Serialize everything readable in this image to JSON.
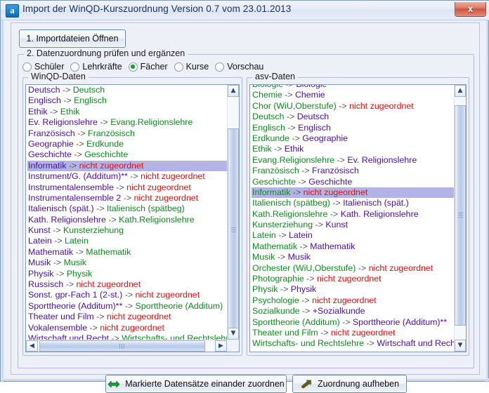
{
  "window": {
    "title": "Import der WinQD-Kurszuordnung Version 0.7 vom 23.01.2013",
    "app_icon": "a",
    "close_label": "x",
    "accent_selection": "#b3b3e8",
    "color_source_left": "#4b0fa0",
    "color_source_right": "#0e8a1e",
    "color_unmapped": "#d81111",
    "color_radio_dot": "#13a438"
  },
  "toolbar": {
    "import_label": "1. Importdateien Öffnen"
  },
  "group": {
    "legend": "2. Datenzuordnung prüfen und ergänzen",
    "radios": [
      {
        "label": "Schüler",
        "checked": false
      },
      {
        "label": "Lehrkräfte",
        "checked": false
      },
      {
        "label": "Fächer",
        "checked": true
      },
      {
        "label": "Kurse",
        "checked": false
      },
      {
        "label": "Vorschau",
        "checked": false
      }
    ]
  },
  "left_panel": {
    "legend": "WinQD-Daten",
    "arrow": "->",
    "items": [
      {
        "source": "Deutsch",
        "target": "Deutsch",
        "mapped": true,
        "selected": false
      },
      {
        "source": "Englisch",
        "target": "Englisch",
        "mapped": true,
        "selected": false
      },
      {
        "source": "Ethik",
        "target": "Ethik",
        "mapped": true,
        "selected": false
      },
      {
        "source": "Ev. Religionslehre",
        "target": "Evang.Religionslehre",
        "mapped": true,
        "selected": false
      },
      {
        "source": "Französisch",
        "target": "Französisch",
        "mapped": true,
        "selected": false
      },
      {
        "source": "Geographie",
        "target": "Erdkunde",
        "mapped": true,
        "selected": false
      },
      {
        "source": "Geschichte",
        "target": "Geschichte",
        "mapped": true,
        "selected": false
      },
      {
        "source": "Informatik",
        "target": "nicht zugeordnet",
        "mapped": false,
        "selected": true
      },
      {
        "source": "Instrument/G. (Additum)**",
        "target": "nicht zugeordnet",
        "mapped": false,
        "selected": false
      },
      {
        "source": "Instrumentalensemble",
        "target": "nicht zugeordnet",
        "mapped": false,
        "selected": false
      },
      {
        "source": "Instrumentalensemble 2",
        "target": "nicht zugeordnet",
        "mapped": false,
        "selected": false
      },
      {
        "source": "Italienisch (spät.)",
        "target": "Italienisch (spätbeg)",
        "mapped": true,
        "selected": false
      },
      {
        "source": "Kath. Religionslehre",
        "target": "Kath.Religionslehre",
        "mapped": true,
        "selected": false
      },
      {
        "source": "Kunst",
        "target": "Kunsterziehung",
        "mapped": true,
        "selected": false
      },
      {
        "source": "Latein",
        "target": "Latein",
        "mapped": true,
        "selected": false
      },
      {
        "source": "Mathematik",
        "target": "Mathematik",
        "mapped": true,
        "selected": false
      },
      {
        "source": "Musik",
        "target": "Musik",
        "mapped": true,
        "selected": false
      },
      {
        "source": "Physik",
        "target": "Physik",
        "mapped": true,
        "selected": false
      },
      {
        "source": "Russisch",
        "target": "nicht zugeordnet",
        "mapped": false,
        "selected": false
      },
      {
        "source": "Sonst. gpr-Fach 1 (2-st.)",
        "target": "nicht zugeordnet",
        "mapped": false,
        "selected": false
      },
      {
        "source": "Sporttheorie (Additum)**",
        "target": "Sporttheorie (Additum)",
        "mapped": true,
        "selected": false
      },
      {
        "source": "Theater und Film",
        "target": "nicht zugeordnet",
        "mapped": false,
        "selected": false
      },
      {
        "source": "Vokalensemble",
        "target": "nicht zugeordnet",
        "mapped": false,
        "selected": false
      },
      {
        "source": "Wirtschaft und Recht",
        "target": "Wirtschafts- und Rechtslehre",
        "mapped": true,
        "selected": false
      }
    ]
  },
  "right_panel": {
    "legend": "asv-Daten",
    "arrow": "->",
    "items": [
      {
        "source": "Biologie",
        "target": "Biologie",
        "mapped": true,
        "selected": false
      },
      {
        "source": "Chemie",
        "target": "Chemie",
        "mapped": true,
        "selected": false
      },
      {
        "source": "Chor (WiU,Oberstufe)",
        "target": "nicht zugeordnet",
        "mapped": false,
        "selected": false
      },
      {
        "source": "Deutsch",
        "target": "Deutsch",
        "mapped": true,
        "selected": false
      },
      {
        "source": "Englisch",
        "target": "Englisch",
        "mapped": true,
        "selected": false
      },
      {
        "source": "Erdkunde",
        "target": "Geographie",
        "mapped": true,
        "selected": false
      },
      {
        "source": "Ethik",
        "target": "Ethik",
        "mapped": true,
        "selected": false
      },
      {
        "source": "Evang.Religionslehre",
        "target": "Ev. Religionslehre",
        "mapped": true,
        "selected": false
      },
      {
        "source": "Französisch",
        "target": "Französisch",
        "mapped": true,
        "selected": false
      },
      {
        "source": "Geschichte",
        "target": "Geschichte",
        "mapped": true,
        "selected": false
      },
      {
        "source": "Informatik",
        "target": "nicht zugeordnet",
        "mapped": false,
        "selected": true
      },
      {
        "source": "Italienisch (spätbeg)",
        "target": "Italienisch (spät.)",
        "mapped": true,
        "selected": false
      },
      {
        "source": "Kath.Religionslehre",
        "target": "Kath. Religionslehre",
        "mapped": true,
        "selected": false
      },
      {
        "source": "Kunsterziehung",
        "target": "Kunst",
        "mapped": true,
        "selected": false
      },
      {
        "source": "Latein",
        "target": "Latein",
        "mapped": true,
        "selected": false
      },
      {
        "source": "Mathematik",
        "target": "Mathematik",
        "mapped": true,
        "selected": false
      },
      {
        "source": "Musik",
        "target": "Musik",
        "mapped": true,
        "selected": false
      },
      {
        "source": "Orchester (WiU,Oberstufe)",
        "target": "nicht zugeordnet",
        "mapped": false,
        "selected": false
      },
      {
        "source": "Photographie",
        "target": "nicht zugeordnet",
        "mapped": false,
        "selected": false
      },
      {
        "source": "Physik",
        "target": "Physik",
        "mapped": true,
        "selected": false
      },
      {
        "source": "Psychologie",
        "target": "nicht zugeordnet",
        "mapped": false,
        "selected": false
      },
      {
        "source": "Sozialkunde",
        "target": "+Sozialkunde",
        "mapped": true,
        "selected": false
      },
      {
        "source": "Sporttheorie (Additum)",
        "target": "Sporttheorie (Additum)**",
        "mapped": true,
        "selected": false
      },
      {
        "source": "Theater und Film",
        "target": "nicht zugeordnet",
        "mapped": false,
        "selected": false
      },
      {
        "source": "Wirtschafts- und Rechtslehre",
        "target": "Wirtschaft und Recht",
        "mapped": true,
        "selected": false
      }
    ]
  },
  "actions": {
    "assign_label": "Markierte Datensätze einander zuordnen",
    "assign_icon": "double-arrow-icon",
    "unassign_label": "Zuordnung aufheben",
    "unassign_icon": "arrow-strikethrough-icon"
  },
  "scrollbars": {
    "up_glyph": "▲",
    "down_glyph": "▼",
    "left_glyph": "◀",
    "right_glyph": "▶"
  }
}
